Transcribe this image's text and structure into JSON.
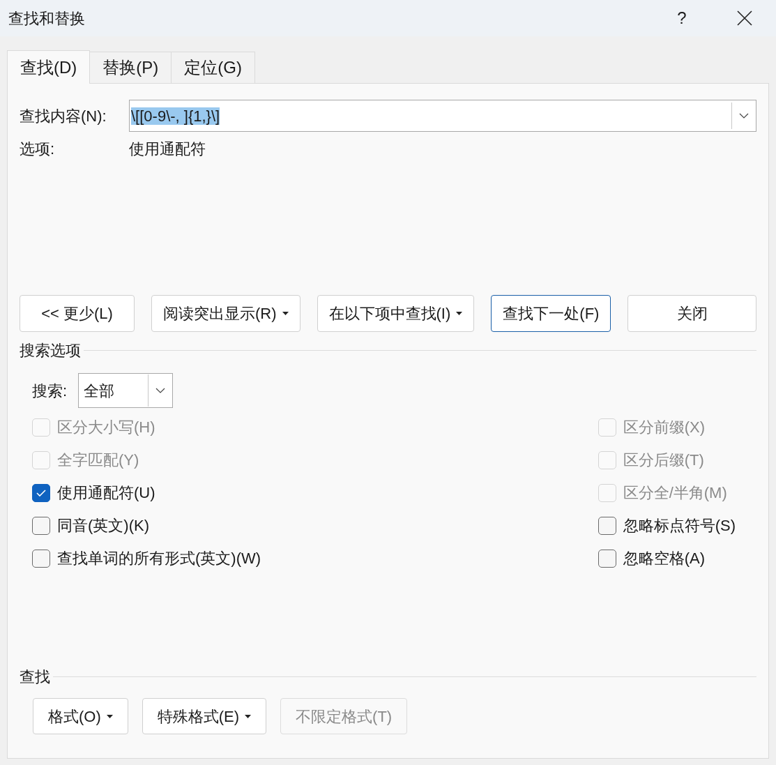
{
  "window": {
    "title": "查找和替换",
    "help": "?"
  },
  "tabs": [
    {
      "label": "查找(D)",
      "selected": true
    },
    {
      "label": "替换(P)",
      "selected": false
    },
    {
      "label": "定位(G)",
      "selected": false
    }
  ],
  "find_field": {
    "label": "查找内容(N):",
    "value": "\\[[0-9\\-, ]{1,}\\]",
    "selected": true
  },
  "options": {
    "label": "选项:",
    "value": "使用通配符"
  },
  "buttons": [
    {
      "label": "<< 更少(L)",
      "dropdown": false,
      "focused": false
    },
    {
      "label": "阅读突出显示(R)",
      "dropdown": true,
      "focused": false
    },
    {
      "label": "在以下项中查找(I)",
      "dropdown": true,
      "focused": false
    },
    {
      "label": "查找下一处(F)",
      "dropdown": false,
      "focused": true
    },
    {
      "label": "关闭",
      "dropdown": false,
      "focused": false
    }
  ],
  "search_options": {
    "title": "搜索选项",
    "search_label": "搜索:",
    "search_value": "全部",
    "left": [
      {
        "label": "区分大小写(H)",
        "checked": false,
        "disabled": true
      },
      {
        "label": "全字匹配(Y)",
        "checked": false,
        "disabled": true
      },
      {
        "label": "使用通配符(U)",
        "checked": true,
        "disabled": false
      },
      {
        "label": "同音(英文)(K)",
        "checked": false,
        "disabled": false
      },
      {
        "label": "查找单词的所有形式(英文)(W)",
        "checked": false,
        "disabled": false
      }
    ],
    "right": [
      {
        "label": "区分前缀(X)",
        "checked": false,
        "disabled": true
      },
      {
        "label": "区分后缀(T)",
        "checked": false,
        "disabled": true
      },
      {
        "label": "区分全/半角(M)",
        "checked": false,
        "disabled": true
      },
      {
        "label": "忽略标点符号(S)",
        "checked": false,
        "disabled": false
      },
      {
        "label": "忽略空格(A)",
        "checked": false,
        "disabled": false
      }
    ]
  },
  "find_section": {
    "title": "查找",
    "buttons": [
      {
        "label": "格式(O)",
        "dropdown": true,
        "disabled": false
      },
      {
        "label": "特殊格式(E)",
        "dropdown": true,
        "disabled": false
      },
      {
        "label": "不限定格式(T)",
        "dropdown": false,
        "disabled": true
      }
    ]
  }
}
